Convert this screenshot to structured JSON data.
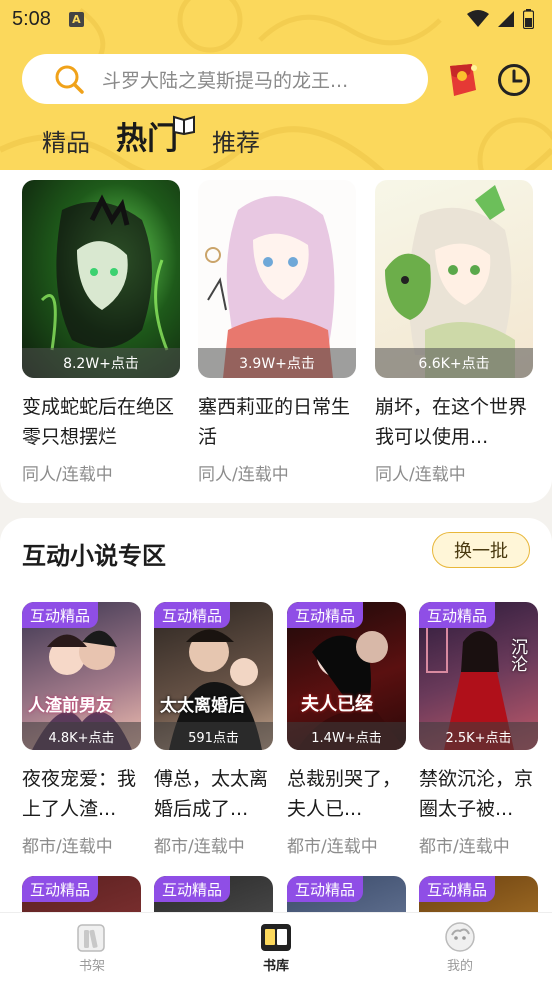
{
  "status_bar": {
    "time": "5:08",
    "sim_letter": "A"
  },
  "search": {
    "placeholder": "斗罗大陆之莫斯提马的龙王..."
  },
  "tabs": [
    {
      "label": "精品",
      "active": false
    },
    {
      "label": "热门",
      "active": true
    },
    {
      "label": "推荐",
      "active": false
    }
  ],
  "hot_books": [
    {
      "title": "变成蛇蛇后在绝区零只想摆烂",
      "clicks": "8.2W+点击",
      "meta": "同人/连载中"
    },
    {
      "title": "塞西莉亚的日常生活",
      "clicks": "3.9W+点击",
      "meta": "同人/连载中"
    },
    {
      "title": "崩坏，在这个世界我可以使用...",
      "clicks": "6.6K+点击",
      "meta": "同人/连载中"
    }
  ],
  "novel_section": {
    "title": "互动小说专区",
    "swap_label": "换一批",
    "tag": "互动精品",
    "books": [
      {
        "title": "夜夜宠爱：我上了人渣...",
        "clicks": "4.8K+点击",
        "meta": "都市/连载中",
        "cover_text": "人渣前男友"
      },
      {
        "title": "傅总，太太离婚后成了...",
        "clicks": "591点击",
        "meta": "都市/连载中",
        "cover_text": "太太离婚后"
      },
      {
        "title": "总裁别哭了，夫人已...",
        "clicks": "1.4W+点击",
        "meta": "都市/连载中",
        "cover_text": "夫人已经"
      },
      {
        "title": "禁欲沉沦，京圈太子被...",
        "clicks": "2.5K+点击",
        "meta": "都市/连载中",
        "cover_text": "沉沦"
      }
    ]
  },
  "bottom_nav": [
    {
      "label": "书架",
      "icon": "bookshelf-icon",
      "active": false
    },
    {
      "label": "书库",
      "icon": "library-icon",
      "active": true
    },
    {
      "label": "我的",
      "icon": "profile-icon",
      "active": false
    }
  ],
  "colors": {
    "accent_yellow": "#fbd85c",
    "tag_purple": "#8f4ee6",
    "swap_border": "#e8b73a"
  }
}
